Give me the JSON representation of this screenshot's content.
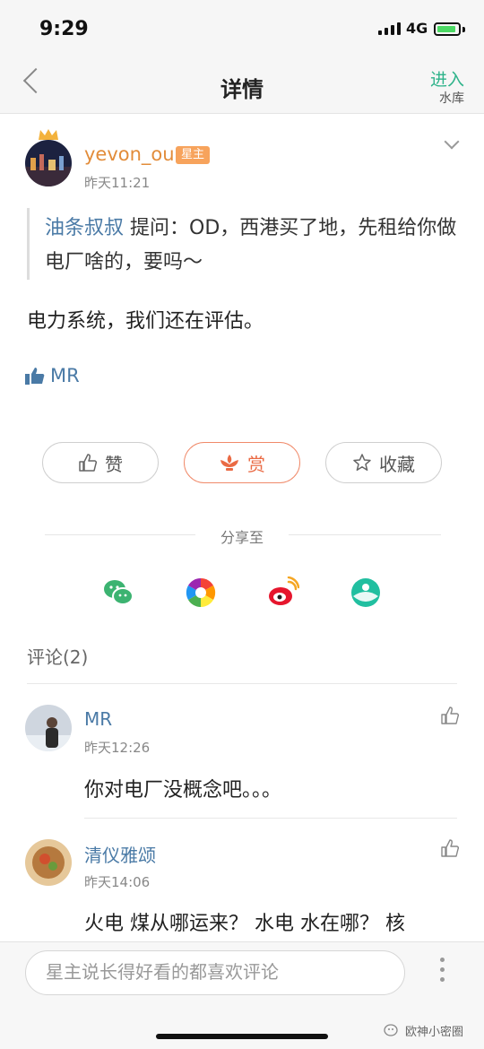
{
  "status_bar": {
    "time": "9:29",
    "network": "4G"
  },
  "nav": {
    "title": "详情",
    "enter_label": "进入",
    "enter_sub": "水库"
  },
  "post": {
    "author": "yevon_ou",
    "badge": "星主",
    "time": "昨天11:21",
    "question_asker": "油条叔叔",
    "question_text": " 提问：OD，西港买了地，先租给你做电厂啥的，要吗～",
    "answer": "电力系统，我们还在评估。",
    "liked_by": "MR"
  },
  "actions": {
    "like": "赞",
    "reward": "赏",
    "collect": "收藏"
  },
  "share": {
    "label": "分享至",
    "icons": [
      "wechat-icon",
      "moments-icon",
      "weibo-icon",
      "qzone-icon"
    ]
  },
  "comments": {
    "title": "评论(2)",
    "items": [
      {
        "name": "MR",
        "time": "昨天12:26",
        "text": "你对电厂没概念吧。。。"
      },
      {
        "name": "清仪雅颂",
        "time": "昨天14:06",
        "text": "火电 煤从哪运来？ 水电 水在哪？ 核"
      }
    ]
  },
  "bottom": {
    "input_placeholder": "星主说长得好看的都喜欢评论",
    "watermark": "欧神小密圈"
  },
  "colors": {
    "accent_green": "#2eb38a",
    "link_blue": "#4a7aa6",
    "reward_orange": "#ea6a44",
    "username_orange": "#e28c3a"
  }
}
